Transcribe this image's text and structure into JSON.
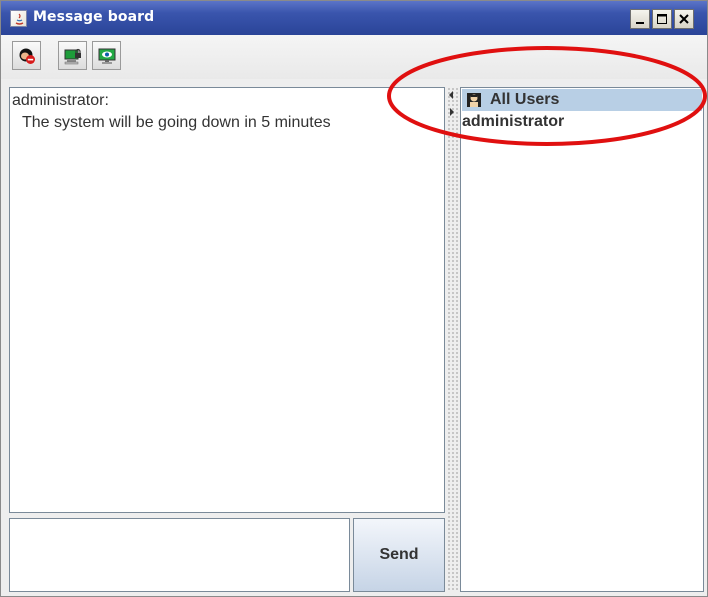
{
  "window": {
    "title": "Message board"
  },
  "toolbar": {
    "buttons": [
      {
        "icon": "user-blocked-icon"
      },
      {
        "icon": "computer-lock-icon"
      },
      {
        "icon": "monitor-eye-icon"
      }
    ]
  },
  "messages": {
    "sender": "administrator:",
    "text": "The system will be going down in 5 minutes"
  },
  "compose": {
    "value": "",
    "send_label": "Send"
  },
  "users": {
    "all_label": "All Users",
    "items": [
      "administrator"
    ]
  },
  "colors": {
    "titlebar": "#3a55ad",
    "selection": "#b8cfe5",
    "annotation": "#e01010"
  }
}
